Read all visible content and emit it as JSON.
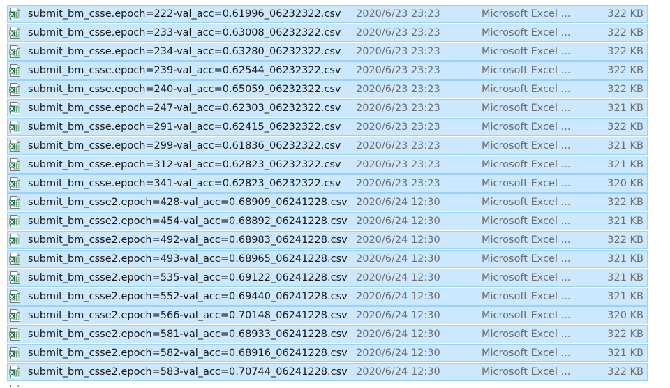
{
  "file_list": {
    "icon": "excel-csv-file-icon",
    "rows": [
      {
        "name": "submit_bm_csse.epoch=222-val_acc=0.61996_06232322.csv",
        "modified": "2020/6/23 23:23",
        "type": "Microsoft Excel ...",
        "size": "322 KB"
      },
      {
        "name": "submit_bm_csse.epoch=233-val_acc=0.63008_06232322.csv",
        "modified": "2020/6/23 23:23",
        "type": "Microsoft Excel ...",
        "size": "322 KB"
      },
      {
        "name": "submit_bm_csse.epoch=234-val_acc=0.63280_06232322.csv",
        "modified": "2020/6/23 23:23",
        "type": "Microsoft Excel ...",
        "size": "322 KB"
      },
      {
        "name": "submit_bm_csse.epoch=239-val_acc=0.62544_06232322.csv",
        "modified": "2020/6/23 23:23",
        "type": "Microsoft Excel ...",
        "size": "322 KB"
      },
      {
        "name": "submit_bm_csse.epoch=240-val_acc=0.65059_06232322.csv",
        "modified": "2020/6/23 23:23",
        "type": "Microsoft Excel ...",
        "size": "322 KB"
      },
      {
        "name": "submit_bm_csse.epoch=247-val_acc=0.62303_06232322.csv",
        "modified": "2020/6/23 23:23",
        "type": "Microsoft Excel ...",
        "size": "321 KB"
      },
      {
        "name": "submit_bm_csse.epoch=291-val_acc=0.62415_06232322.csv",
        "modified": "2020/6/23 23:23",
        "type": "Microsoft Excel ...",
        "size": "322 KB"
      },
      {
        "name": "submit_bm_csse.epoch=299-val_acc=0.61836_06232322.csv",
        "modified": "2020/6/23 23:23",
        "type": "Microsoft Excel ...",
        "size": "321 KB"
      },
      {
        "name": "submit_bm_csse.epoch=312-val_acc=0.62823_06232322.csv",
        "modified": "2020/6/23 23:23",
        "type": "Microsoft Excel ...",
        "size": "321 KB"
      },
      {
        "name": "submit_bm_csse.epoch=341-val_acc=0.62823_06232322.csv",
        "modified": "2020/6/23 23:23",
        "type": "Microsoft Excel ...",
        "size": "320 KB"
      },
      {
        "name": "submit_bm_csse2.epoch=428-val_acc=0.68909_06241228.csv",
        "modified": "2020/6/24 12:30",
        "type": "Microsoft Excel ...",
        "size": "322 KB"
      },
      {
        "name": "submit_bm_csse2.epoch=454-val_acc=0.68892_06241228.csv",
        "modified": "2020/6/24 12:30",
        "type": "Microsoft Excel ...",
        "size": "321 KB"
      },
      {
        "name": "submit_bm_csse2.epoch=492-val_acc=0.68983_06241228.csv",
        "modified": "2020/6/24 12:30",
        "type": "Microsoft Excel ...",
        "size": "322 KB"
      },
      {
        "name": "submit_bm_csse2.epoch=493-val_acc=0.68965_06241228.csv",
        "modified": "2020/6/24 12:30",
        "type": "Microsoft Excel ...",
        "size": "321 KB"
      },
      {
        "name": "submit_bm_csse2.epoch=535-val_acc=0.69122_06241228.csv",
        "modified": "2020/6/24 12:30",
        "type": "Microsoft Excel ...",
        "size": "321 KB"
      },
      {
        "name": "submit_bm_csse2.epoch=552-val_acc=0.69440_06241228.csv",
        "modified": "2020/6/24 12:30",
        "type": "Microsoft Excel ...",
        "size": "321 KB"
      },
      {
        "name": "submit_bm_csse2.epoch=566-val_acc=0.70148_06241228.csv",
        "modified": "2020/6/24 12:30",
        "type": "Microsoft Excel ...",
        "size": "320 KB"
      },
      {
        "name": "submit_bm_csse2.epoch=581-val_acc=0.68933_06241228.csv",
        "modified": "2020/6/24 12:30",
        "type": "Microsoft Excel ...",
        "size": "322 KB"
      },
      {
        "name": "submit_bm_csse2.epoch=582-val_acc=0.68916_06241228.csv",
        "modified": "2020/6/24 12:30",
        "type": "Microsoft Excel ...",
        "size": "321 KB"
      },
      {
        "name": "submit_bm_csse2.epoch=583-val_acc=0.70744_06241228.csv",
        "modified": "2020/6/24 12:30",
        "type": "Microsoft Excel ...",
        "size": "322 KB"
      }
    ]
  },
  "colors": {
    "selection_background": "#cce8ff",
    "selection_border": "#99d1ff",
    "secondary_text": "#6d6d6d"
  }
}
